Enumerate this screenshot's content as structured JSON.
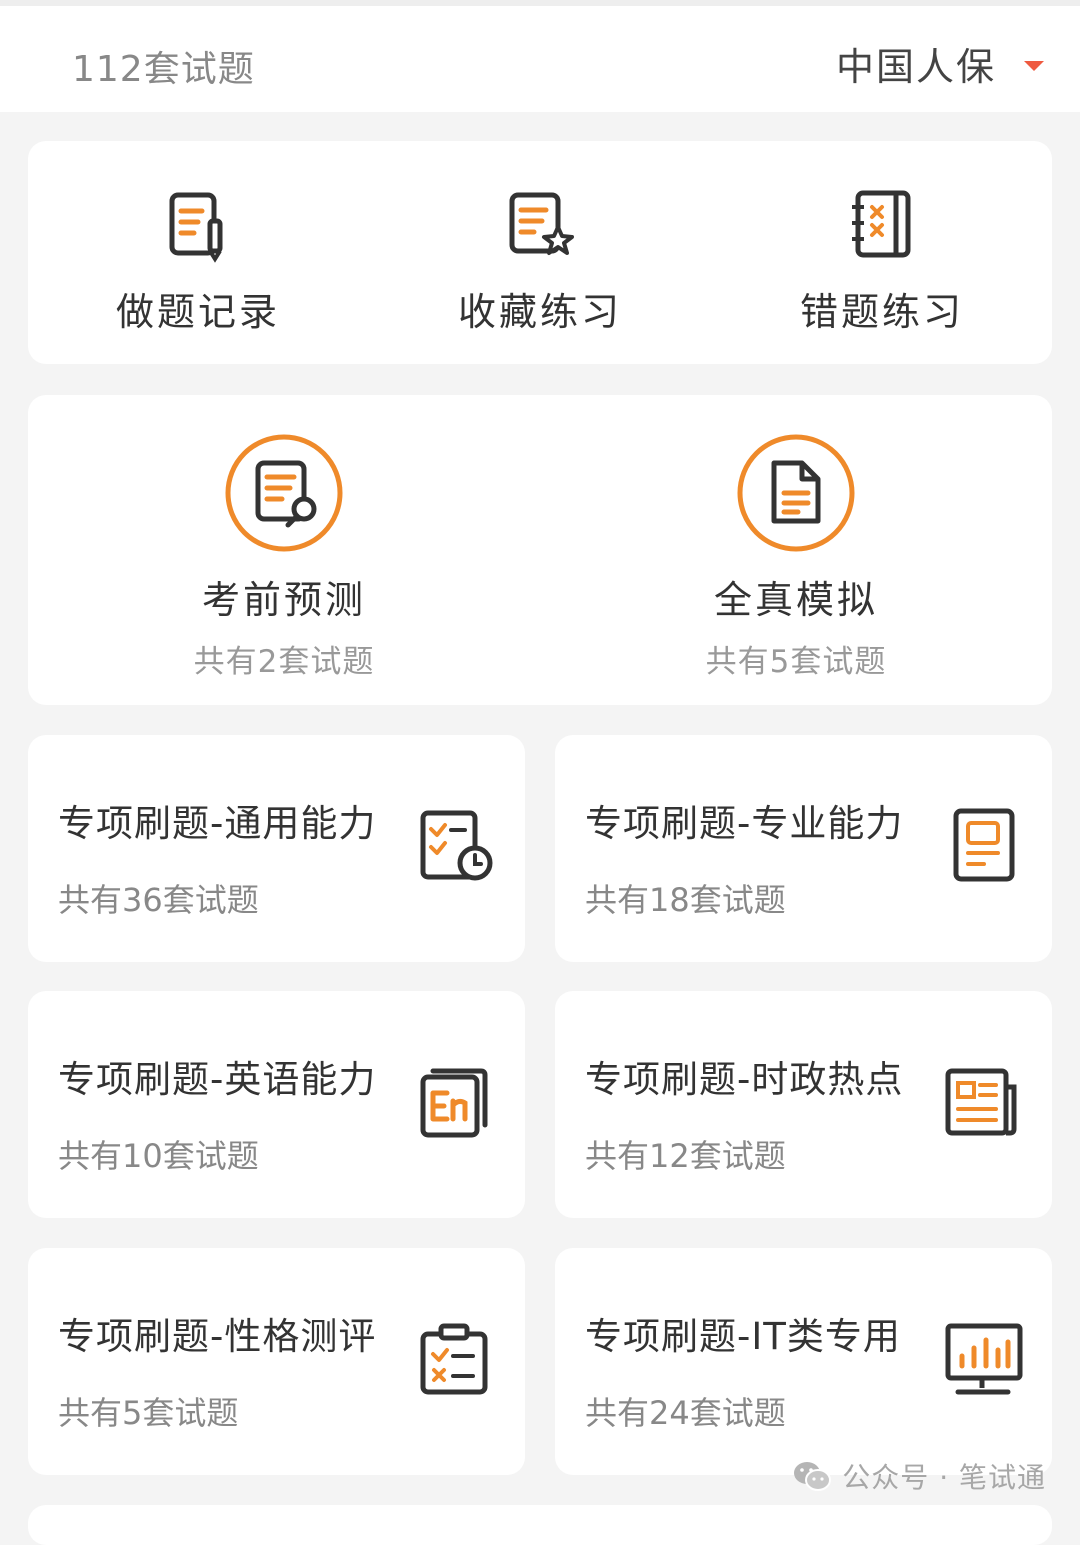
{
  "header": {
    "count_label": "112套试题",
    "company": "中国人保"
  },
  "quick_actions": [
    {
      "label": "做题记录",
      "icon": "record-icon"
    },
    {
      "label": "收藏练习",
      "icon": "favorite-icon"
    },
    {
      "label": "错题练习",
      "icon": "mistake-book-icon"
    }
  ],
  "exams": [
    {
      "title": "考前预测",
      "sub": "共有2套试题",
      "icon": "document-search-icon"
    },
    {
      "title": "全真模拟",
      "sub": "共有5套试题",
      "icon": "document-icon"
    }
  ],
  "topics": [
    {
      "title": "专项刷题-通用能力",
      "sub": "共有36套试题",
      "icon": "checklist-clock-icon"
    },
    {
      "title": "专项刷题-专业能力",
      "sub": "共有18套试题",
      "icon": "report-icon"
    },
    {
      "title": "专项刷题-英语能力",
      "sub": "共有10套试题",
      "icon": "english-icon"
    },
    {
      "title": "专项刷题-时政热点",
      "sub": "共有12套试题",
      "icon": "newspaper-icon"
    },
    {
      "title": "专项刷题-性格测评",
      "sub": "共有5套试题",
      "icon": "clipboard-check-icon"
    },
    {
      "title": "专项刷题-IT类专用",
      "sub": "共有24套试题",
      "icon": "monitor-chart-icon"
    }
  ],
  "watermark": {
    "text": "公众号 · 笔试通"
  },
  "colors": {
    "accent": "#ef8a2a",
    "icon_stroke": "#333333",
    "caret": "#ef5a40"
  }
}
